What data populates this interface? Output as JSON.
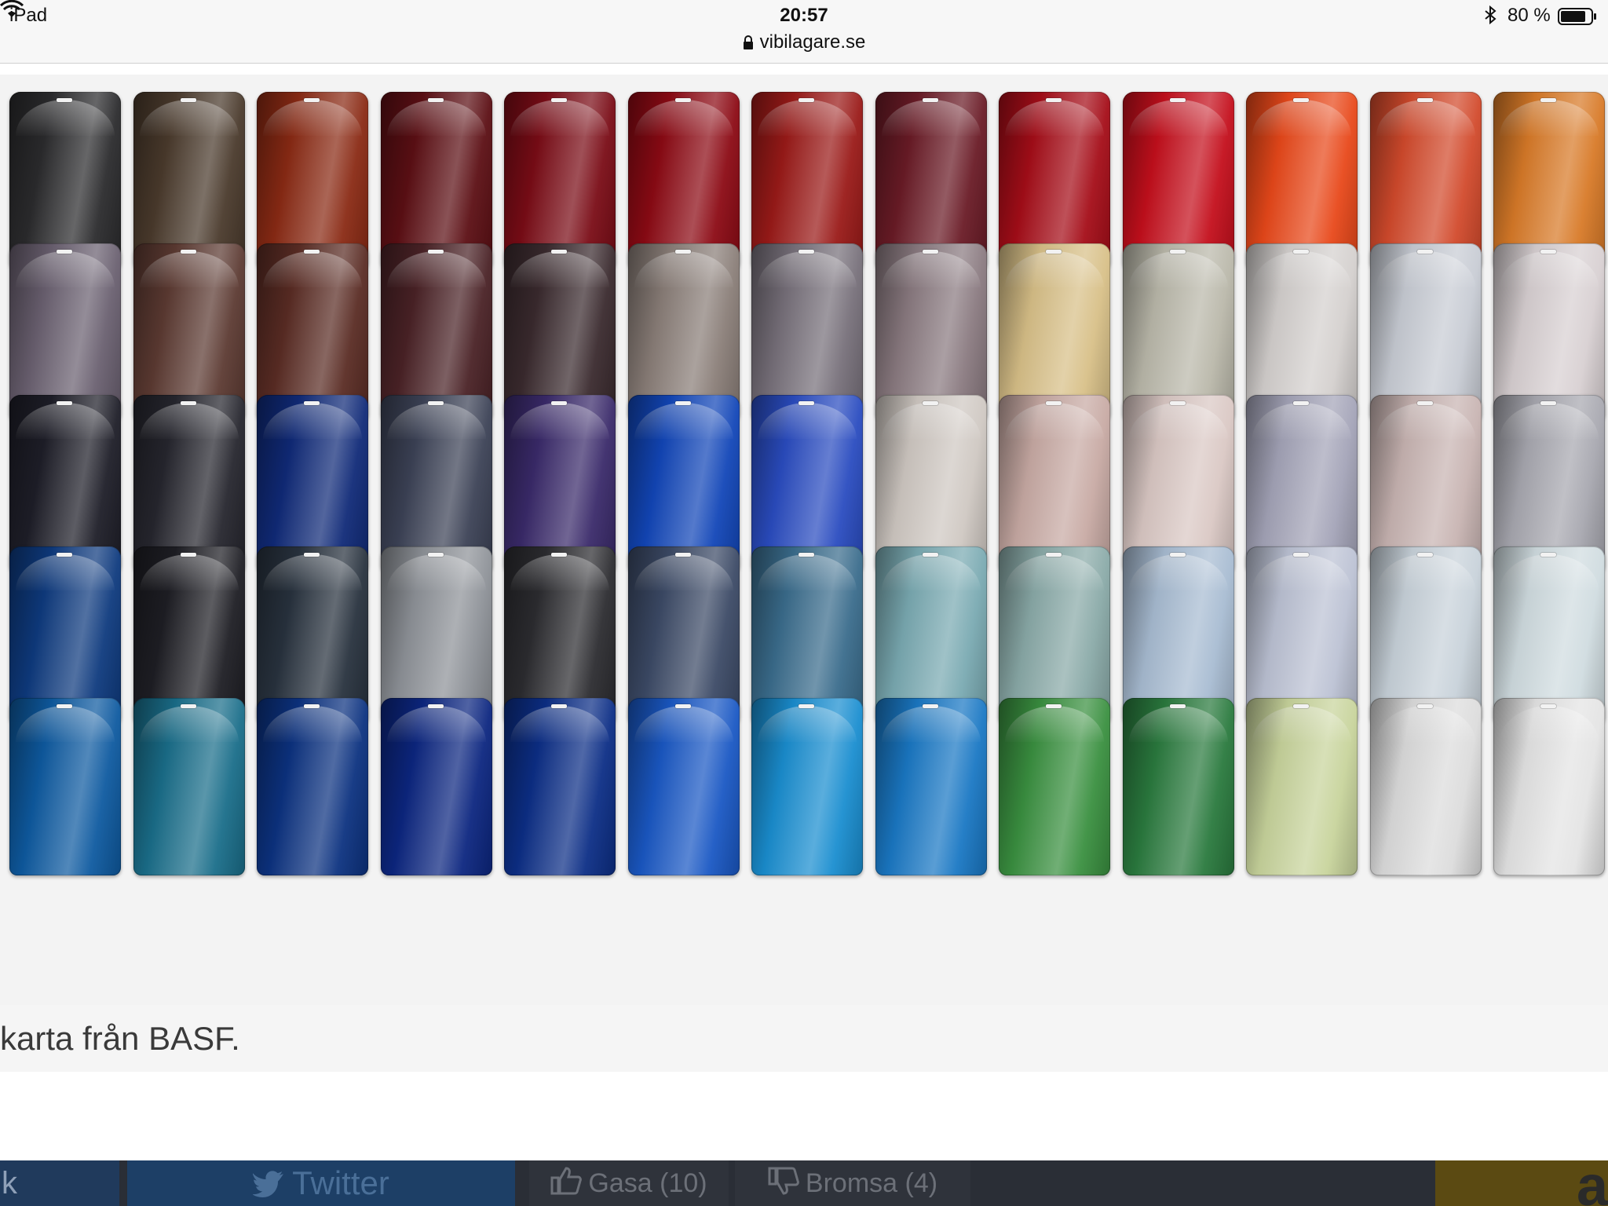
{
  "status_bar": {
    "device": "iPad",
    "time": "20:57",
    "url": "vibilagare.se",
    "battery": "80 %",
    "icons": [
      "wifi-icon",
      "lock-icon",
      "bluetooth-icon",
      "battery-icon"
    ]
  },
  "image": {
    "caption": "karta från BASF.",
    "swatch_colors": [
      [
        "#2b2b2d",
        "#4a3a2c",
        "#8a2a14",
        "#5c0f14",
        "#7a0c16",
        "#8c0a14",
        "#9a1a18",
        "#6a1b26",
        "#a50d18",
        "#c40f1c",
        "#e8481a",
        "#d24a2c",
        "#d87a28"
      ],
      [
        "#6a6070",
        "#5c3a32",
        "#5a2c24",
        "#4a2226",
        "#3a2a2e",
        "#8a7e78",
        "#77707a",
        "#8a7a80",
        "#d8c088",
        "#bab8aa",
        "#d4d0ce",
        "#c8ccd4",
        "#d8d0d2"
      ],
      [
        "#1e1e28",
        "#26262e",
        "#102a78",
        "#3c4256",
        "#3a2a6a",
        "#1246b8",
        "#2a4cc0",
        "#cfc8c2",
        "#c8aaa4",
        "#dac8c4",
        "#a4a4b8",
        "#c8b4b2",
        "#a8a8b0"
      ],
      [
        "#0e3a7e",
        "#1e1e24",
        "#28323e",
        "#8e9298",
        "#2c2c30",
        "#3c4a66",
        "#3a6c8c",
        "#7aaab2",
        "#8aaaa8",
        "#a8bcd2",
        "#bcc2d4",
        "#c8d2da",
        "#d0dce0"
      ],
      [
        "#0e5aa0",
        "#1a6e8a",
        "#0c3280",
        "#0c2680",
        "#0c2e86",
        "#1a58c4",
        "#1a8ed0",
        "#1a78c4",
        "#3a9040",
        "#2a7a3e",
        "#c8d49c",
        "#dcdcdc",
        "#e4e4e4"
      ]
    ]
  },
  "share_bar": {
    "left_fragment": "k",
    "twitter": "Twitter",
    "gasa": "Gasa (10)",
    "bromsa": "Bromsa (4)",
    "right_fragment": "a"
  }
}
